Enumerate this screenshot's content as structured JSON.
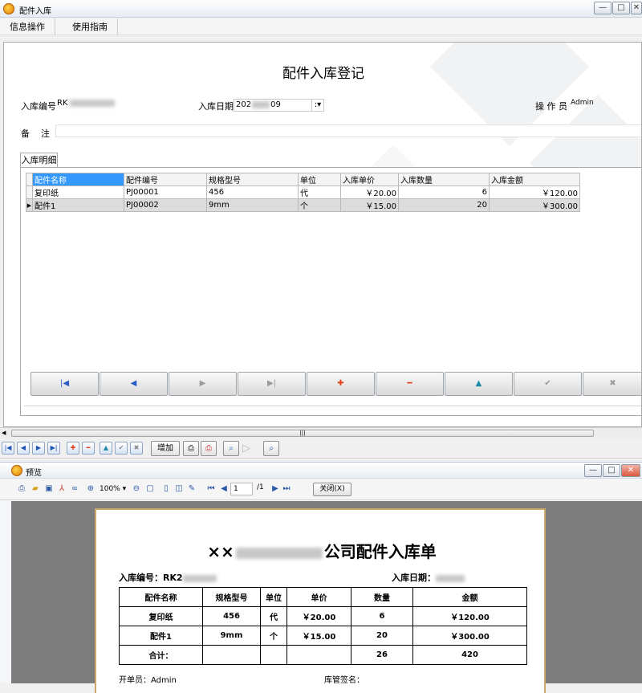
{
  "window": {
    "title": "配件入库",
    "min": "—",
    "max": "□",
    "close": "✕"
  },
  "menu": [
    {
      "label": "信息操作"
    },
    {
      "label": "使用指南"
    }
  ],
  "form": {
    "title": "配件入库登记",
    "order_no_label": "入库编号",
    "order_no_prefix": "RK",
    "date_label": "入库日期",
    "date_prefix": "202",
    "date_suffix": "09",
    "date_dropdown": ":▾",
    "operator_label": "操 作 员",
    "operator_value": "Admin",
    "remark_label": "备    注",
    "remark_value": ""
  },
  "tab": {
    "label": "入库明细"
  },
  "grid": {
    "columns": [
      "配件名称",
      "配件编号",
      "规格型号",
      "单位",
      "入库单价",
      "入库数量",
      "入库金额"
    ],
    "rows": [
      {
        "name": "复印纸",
        "code": "PJ00001",
        "spec": "456",
        "unit": "代",
        "price": "￥20.00",
        "qty": "6",
        "amount": "￥120.00"
      },
      {
        "name": "配件1",
        "code": "PJ00002",
        "spec": "9mm",
        "unit": "个",
        "price": "￥15.00",
        "qty": "20",
        "amount": "￥300.00"
      }
    ]
  },
  "nav_buttons": [
    {
      "name": "first",
      "glyph": "|◀",
      "color": "#2a5cc4"
    },
    {
      "name": "prev",
      "glyph": "◀",
      "color": "#2a5cc4"
    },
    {
      "name": "next",
      "glyph": "▶",
      "color": "#9a9a9a"
    },
    {
      "name": "last",
      "glyph": "▶|",
      "color": "#9a9a9a"
    },
    {
      "name": "add",
      "glyph": "✚",
      "color": "#e0421a"
    },
    {
      "name": "delete",
      "glyph": "━",
      "color": "#e0421a"
    },
    {
      "name": "edit",
      "glyph": "▲",
      "color": "#1f8aa8"
    },
    {
      "name": "confirm",
      "glyph": "✔",
      "color": "#9a9a9a"
    },
    {
      "name": "cancel",
      "glyph": "✖",
      "color": "#9a9a9a"
    }
  ],
  "scroll": {
    "grip": "|||"
  },
  "toolbar": {
    "add_label": "增加"
  },
  "preview": {
    "title": "预览",
    "zoom": "100%",
    "page_current": "1",
    "page_total": "/1",
    "close_label": "关闭(X)",
    "report_title_prefix": "××",
    "report_title_suffix": "公司配件入库单",
    "order_no_label": "入库编号：RK2",
    "date_label": "入库日期：",
    "columns": [
      "配件名称",
      "规格型号",
      "单位",
      "单价",
      "数量",
      "金额"
    ],
    "rows": [
      {
        "name": "复印纸",
        "spec": "456",
        "unit": "代",
        "price": "￥20.00",
        "qty": "6",
        "amount": "￥120.00"
      },
      {
        "name": "配件1",
        "spec": "9mm",
        "unit": "个",
        "price": "￥15.00",
        "qty": "20",
        "amount": "￥300.00"
      }
    ],
    "total_label": "合计：",
    "total_qty": "26",
    "total_amount": "420",
    "creator_label": "开单员：Admin",
    "keeper_label": "库管签名："
  }
}
